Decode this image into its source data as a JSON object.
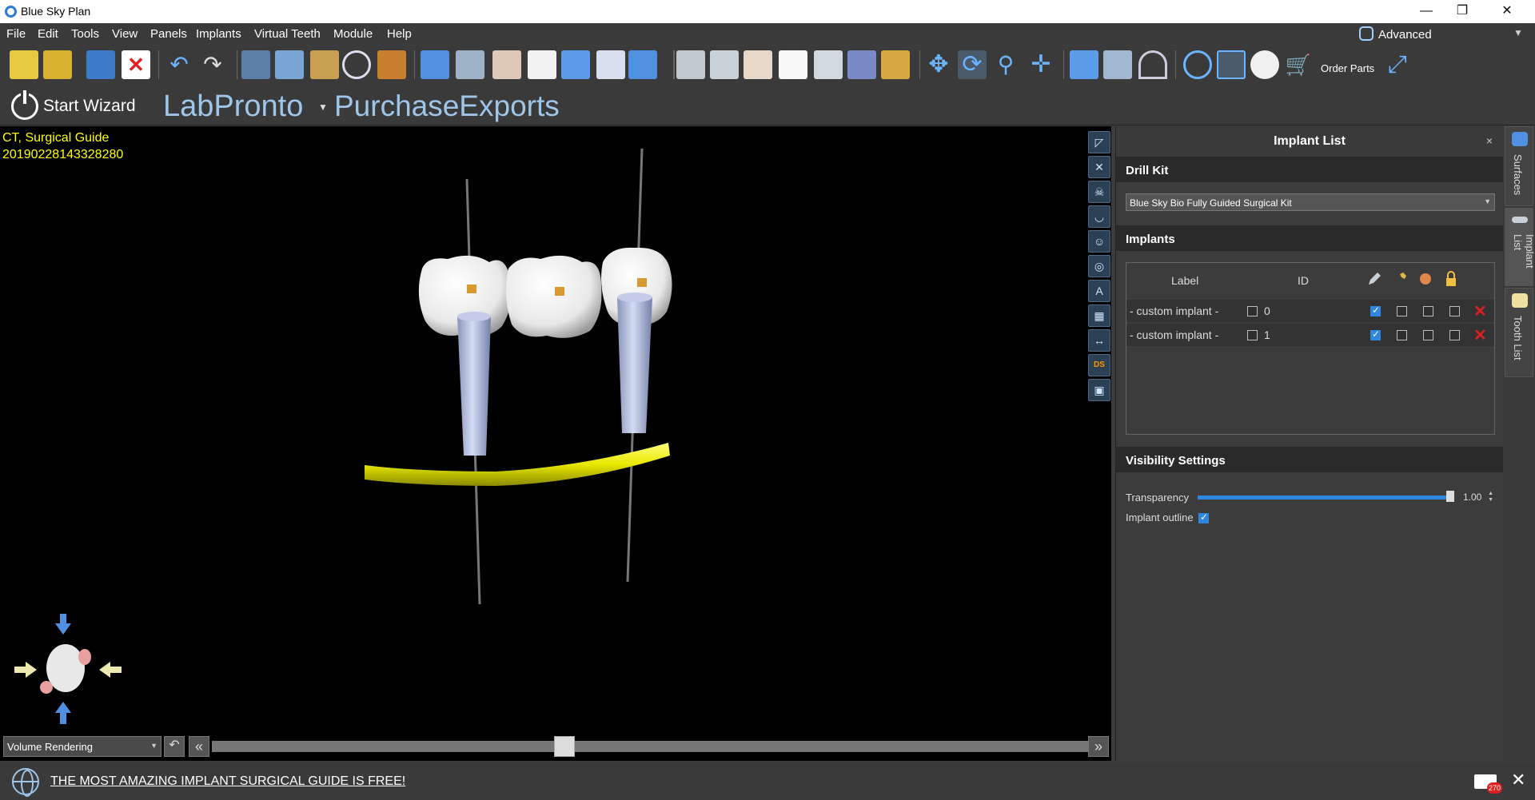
{
  "window": {
    "title": "Blue Sky Plan",
    "minimize": "—",
    "restore": "❐",
    "close": "✕"
  },
  "menu": [
    "File",
    "Edit",
    "Tools",
    "View",
    "Panels",
    "Implants",
    "Virtual Teeth",
    "Module",
    "Help"
  ],
  "mode": {
    "label": "Advanced",
    "arrow": "▼"
  },
  "toolbar": {
    "order_parts": "Order Parts",
    "icons": [
      "new-file-icon",
      "open-file-icon",
      "save-icon",
      "close-file-icon",
      "undo-icon",
      "redo-icon",
      "table-icon",
      "scan-icon",
      "panorama-icon",
      "inspect-icon",
      "measure-path-icon",
      "arch-icon",
      "implant-add-icon",
      "crown-add-icon",
      "tooth-add-icon",
      "nerve-icon",
      "sleeve-add-icon",
      "settings-list-icon",
      "implant-icon",
      "screw-icon",
      "denture-icon",
      "tooth-icon",
      "abutment-icon",
      "house-icon",
      "lock-eye-icon",
      "move-icon",
      "rotate-icon",
      "zoom-icon",
      "pan-icon",
      "histogram-icon",
      "ruler-icon",
      "angle-icon",
      "reset-view-icon",
      "slice-icon",
      "cloud-icon",
      "cart-icon",
      "fullscreen-icon"
    ]
  },
  "wizard": {
    "start_label": "Start Wizard",
    "labpronto": "LabPronto",
    "dropdown_arrow": "▼",
    "purchase": "PurchaseExports"
  },
  "viewport": {
    "info_line1": "CT, Surgical Guide",
    "info_line2": "20190228143328280",
    "render_mode": "Volume Rendering",
    "slice_position": 0.4,
    "tools": [
      {
        "name": "view-toggle-icon",
        "glyph": "◸"
      },
      {
        "name": "crosshair-icon",
        "glyph": "✕"
      },
      {
        "name": "skull-icon",
        "glyph": "☠"
      },
      {
        "name": "arch-view-icon",
        "glyph": "◡"
      },
      {
        "name": "face-icon",
        "glyph": "☺"
      },
      {
        "name": "target-icon",
        "glyph": "◎"
      },
      {
        "name": "annotation-text-icon",
        "glyph": "A"
      },
      {
        "name": "grid-icon",
        "glyph": "▦"
      },
      {
        "name": "distance-icon",
        "glyph": "↔"
      },
      {
        "name": "ds-icon",
        "glyph": "DS"
      },
      {
        "name": "screenshot-icon",
        "glyph": "▣"
      }
    ]
  },
  "panel": {
    "title": "Implant List",
    "close": "×",
    "drill_kit_header": "Drill Kit",
    "drill_kit_value": "Blue Sky Bio Fully Guided Surgical Kit",
    "implants_header": "Implants",
    "columns": {
      "label": "Label",
      "id": "ID"
    },
    "rows": [
      {
        "label": "- custom implant -",
        "id": "0",
        "id_checked": false,
        "visible": true,
        "c2": false,
        "c3": false,
        "c4": false
      },
      {
        "label": "- custom implant -",
        "id": "1",
        "id_checked": false,
        "visible": true,
        "c2": false,
        "c3": false,
        "c4": false
      }
    ],
    "visibility_header": "Visibility Settings",
    "transparency_label": "Transparency",
    "transparency_value": "1.00",
    "transparency_level": 1.0,
    "outline_label": "Implant outline",
    "outline_checked": true
  },
  "side_tabs": [
    "Surfaces",
    "Implant List",
    "Tooth List"
  ],
  "status": {
    "promo": "THE MOST AMAZING IMPLANT SURGICAL GUIDE IS FREE!",
    "mail_count": "270",
    "close": "✕"
  },
  "colors": {
    "accent": "#2e86de",
    "brand": "#9fc5e8",
    "info_text": "#ffff00",
    "nerve": "#e8e800",
    "delete": "#e02020"
  }
}
